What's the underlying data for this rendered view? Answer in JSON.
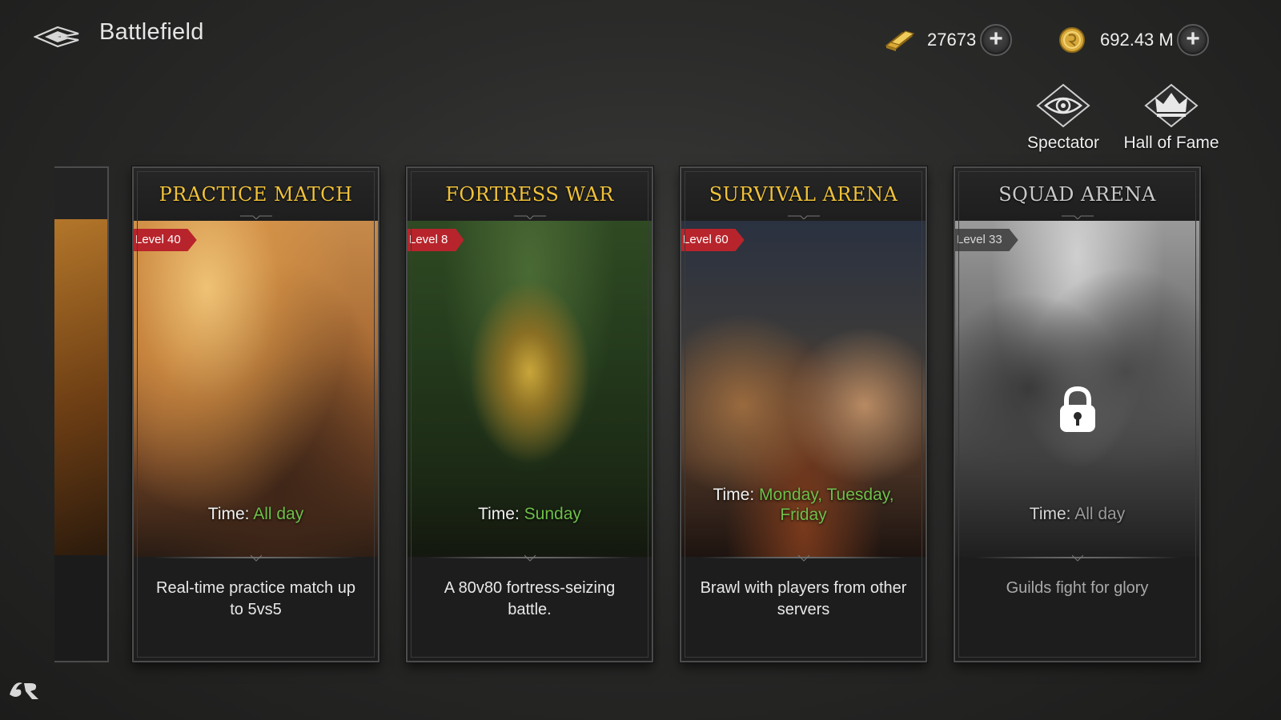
{
  "header": {
    "title": "Battlefield"
  },
  "currencies": [
    {
      "icon": "gold-bar-icon",
      "value": "27673"
    },
    {
      "icon": "gold-coin-icon",
      "value": "692.43 M"
    }
  ],
  "quick_actions": [
    {
      "label": "Spectator",
      "icon": "eye-icon"
    },
    {
      "label": "Hall of Fame",
      "icon": "crown-icon"
    }
  ],
  "cards": [
    {
      "title": "PRACTICE MATCH",
      "level": "Level 40",
      "time_label": "Time:",
      "time_value": "All day",
      "description": "Real-time practice match up to 5vs5",
      "locked": false
    },
    {
      "title": "FORTRESS WAR",
      "level": "Level 8",
      "time_label": "Time:",
      "time_value": "Sunday",
      "description": "A 80v80 fortress-seizing battle.",
      "locked": false
    },
    {
      "title": "SURVIVAL ARENA",
      "level": "Level 60",
      "time_label": "Time:",
      "time_value": "Monday, Tuesday, Friday",
      "description": "Brawl with players from other servers",
      "locked": false
    },
    {
      "title": "SQUAD ARENA",
      "level": "Level 33",
      "time_label": "Time:",
      "time_value": "All day",
      "description": "Guilds fight for glory",
      "locked": true
    }
  ],
  "colors": {
    "title_gold": "#f0c23a",
    "time_green": "#6fbf4a",
    "level_red": "#b8242b",
    "locked_gray": "#4a4a4a"
  }
}
